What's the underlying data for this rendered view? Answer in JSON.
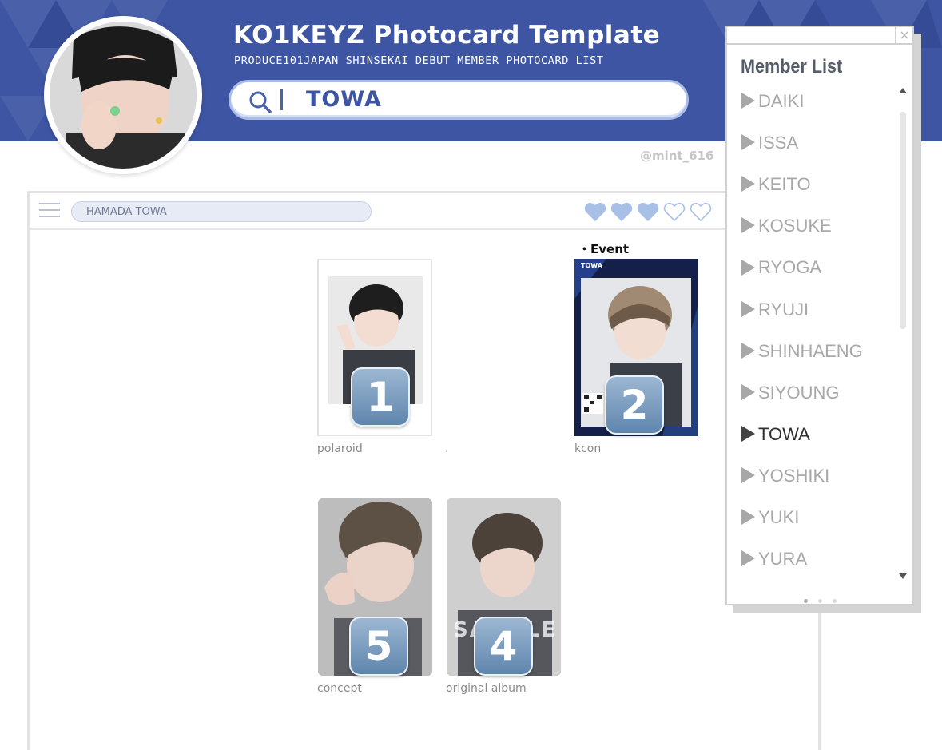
{
  "header": {
    "title": "KO1KEYZ Photocard Template",
    "subtitle": "PRODUCE101JAPAN SHINSEKAI DEBUT MEMBER PHOTOCARD LIST",
    "search_query": "TOWA",
    "credit": "@mint_616"
  },
  "window": {
    "address_text": "HAMADA TOWA",
    "hearts": {
      "filled": 3,
      "total": 5
    },
    "section_label": "・Event",
    "cards": [
      {
        "caption": "polaroid",
        "number": "1"
      },
      {
        "caption": "kcon",
        "number": "2",
        "card_name": "TOWA"
      },
      {
        "caption": "concept",
        "number": "5"
      },
      {
        "caption": "original album",
        "number": "4",
        "watermark": "SAMPLE"
      }
    ],
    "stray_mark": "."
  },
  "member_list": {
    "title": "Member List",
    "close_glyph": "×",
    "members": [
      "DAIKI",
      "ISSA",
      "KEITO",
      "KOSUKE",
      "RYOGA",
      "RYUJI",
      "SHINHAENG",
      "SIYOUNG",
      "TOWA",
      "YOSHIKI",
      "YUKI",
      "YURA"
    ],
    "selected": "TOWA",
    "page_dots": {
      "count": 3,
      "active": 1
    }
  },
  "colors": {
    "banner": "#3d55a3",
    "accent_light": "#a9bde8",
    "heart": "#a9c0e6"
  }
}
